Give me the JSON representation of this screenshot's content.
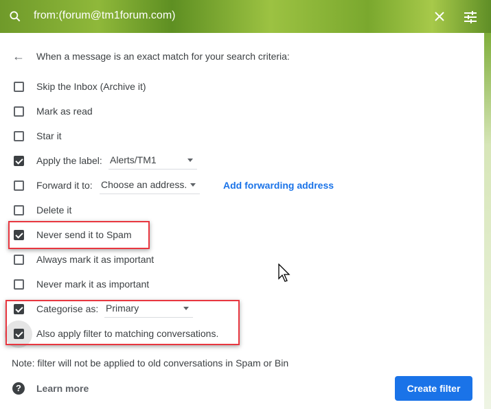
{
  "search": {
    "query": "from:(forum@tm1forum.com)",
    "icon": "search-icon",
    "clear_icon": "close-icon",
    "options_icon": "tune-icon"
  },
  "intro": "When a message is an exact match for your search criteria:",
  "options": [
    {
      "label": "Skip the Inbox (Archive it)",
      "checked": false
    },
    {
      "label": "Mark as read",
      "checked": false
    },
    {
      "label": "Star it",
      "checked": false
    },
    {
      "label": "Apply the label:",
      "checked": true,
      "dropdown": "Alerts/TM1"
    },
    {
      "label": "Forward it to:",
      "checked": false,
      "dropdown": "Choose an address.",
      "link": "Add forwarding address"
    },
    {
      "label": "Delete it",
      "checked": false
    },
    {
      "label": "Never send it to Spam",
      "checked": true
    },
    {
      "label": "Always mark it as important",
      "checked": false
    },
    {
      "label": "Never mark it as important",
      "checked": false
    },
    {
      "label": "Categorise as:",
      "checked": true,
      "dropdown": "Primary"
    },
    {
      "label": "Also apply filter to matching conversations.",
      "checked": true
    }
  ],
  "note": "Note: filter will not be applied to old conversations in Spam or Bin",
  "learn_more": "Learn more",
  "help_glyph": "?",
  "create_filter": "Create filter",
  "colors": {
    "accent": "#1a73e8",
    "highlight": "#e8363f"
  }
}
